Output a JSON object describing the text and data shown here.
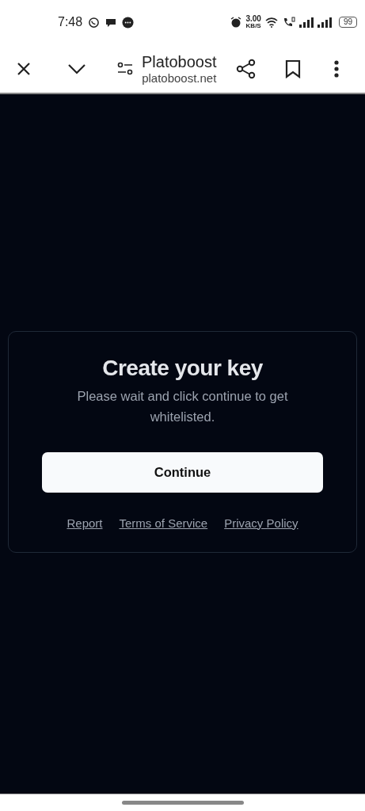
{
  "status_bar": {
    "time": "7:48",
    "net_speed": "3.00",
    "net_unit": "KB/S",
    "battery": "99"
  },
  "toolbar": {
    "title": "Platoboost",
    "url": "platoboost.net"
  },
  "card": {
    "title": "Create your key",
    "text": "Please wait and click continue to get whitelisted.",
    "button": "Continue",
    "links": [
      "Report",
      "Terms of Service",
      "Privacy Policy"
    ]
  }
}
